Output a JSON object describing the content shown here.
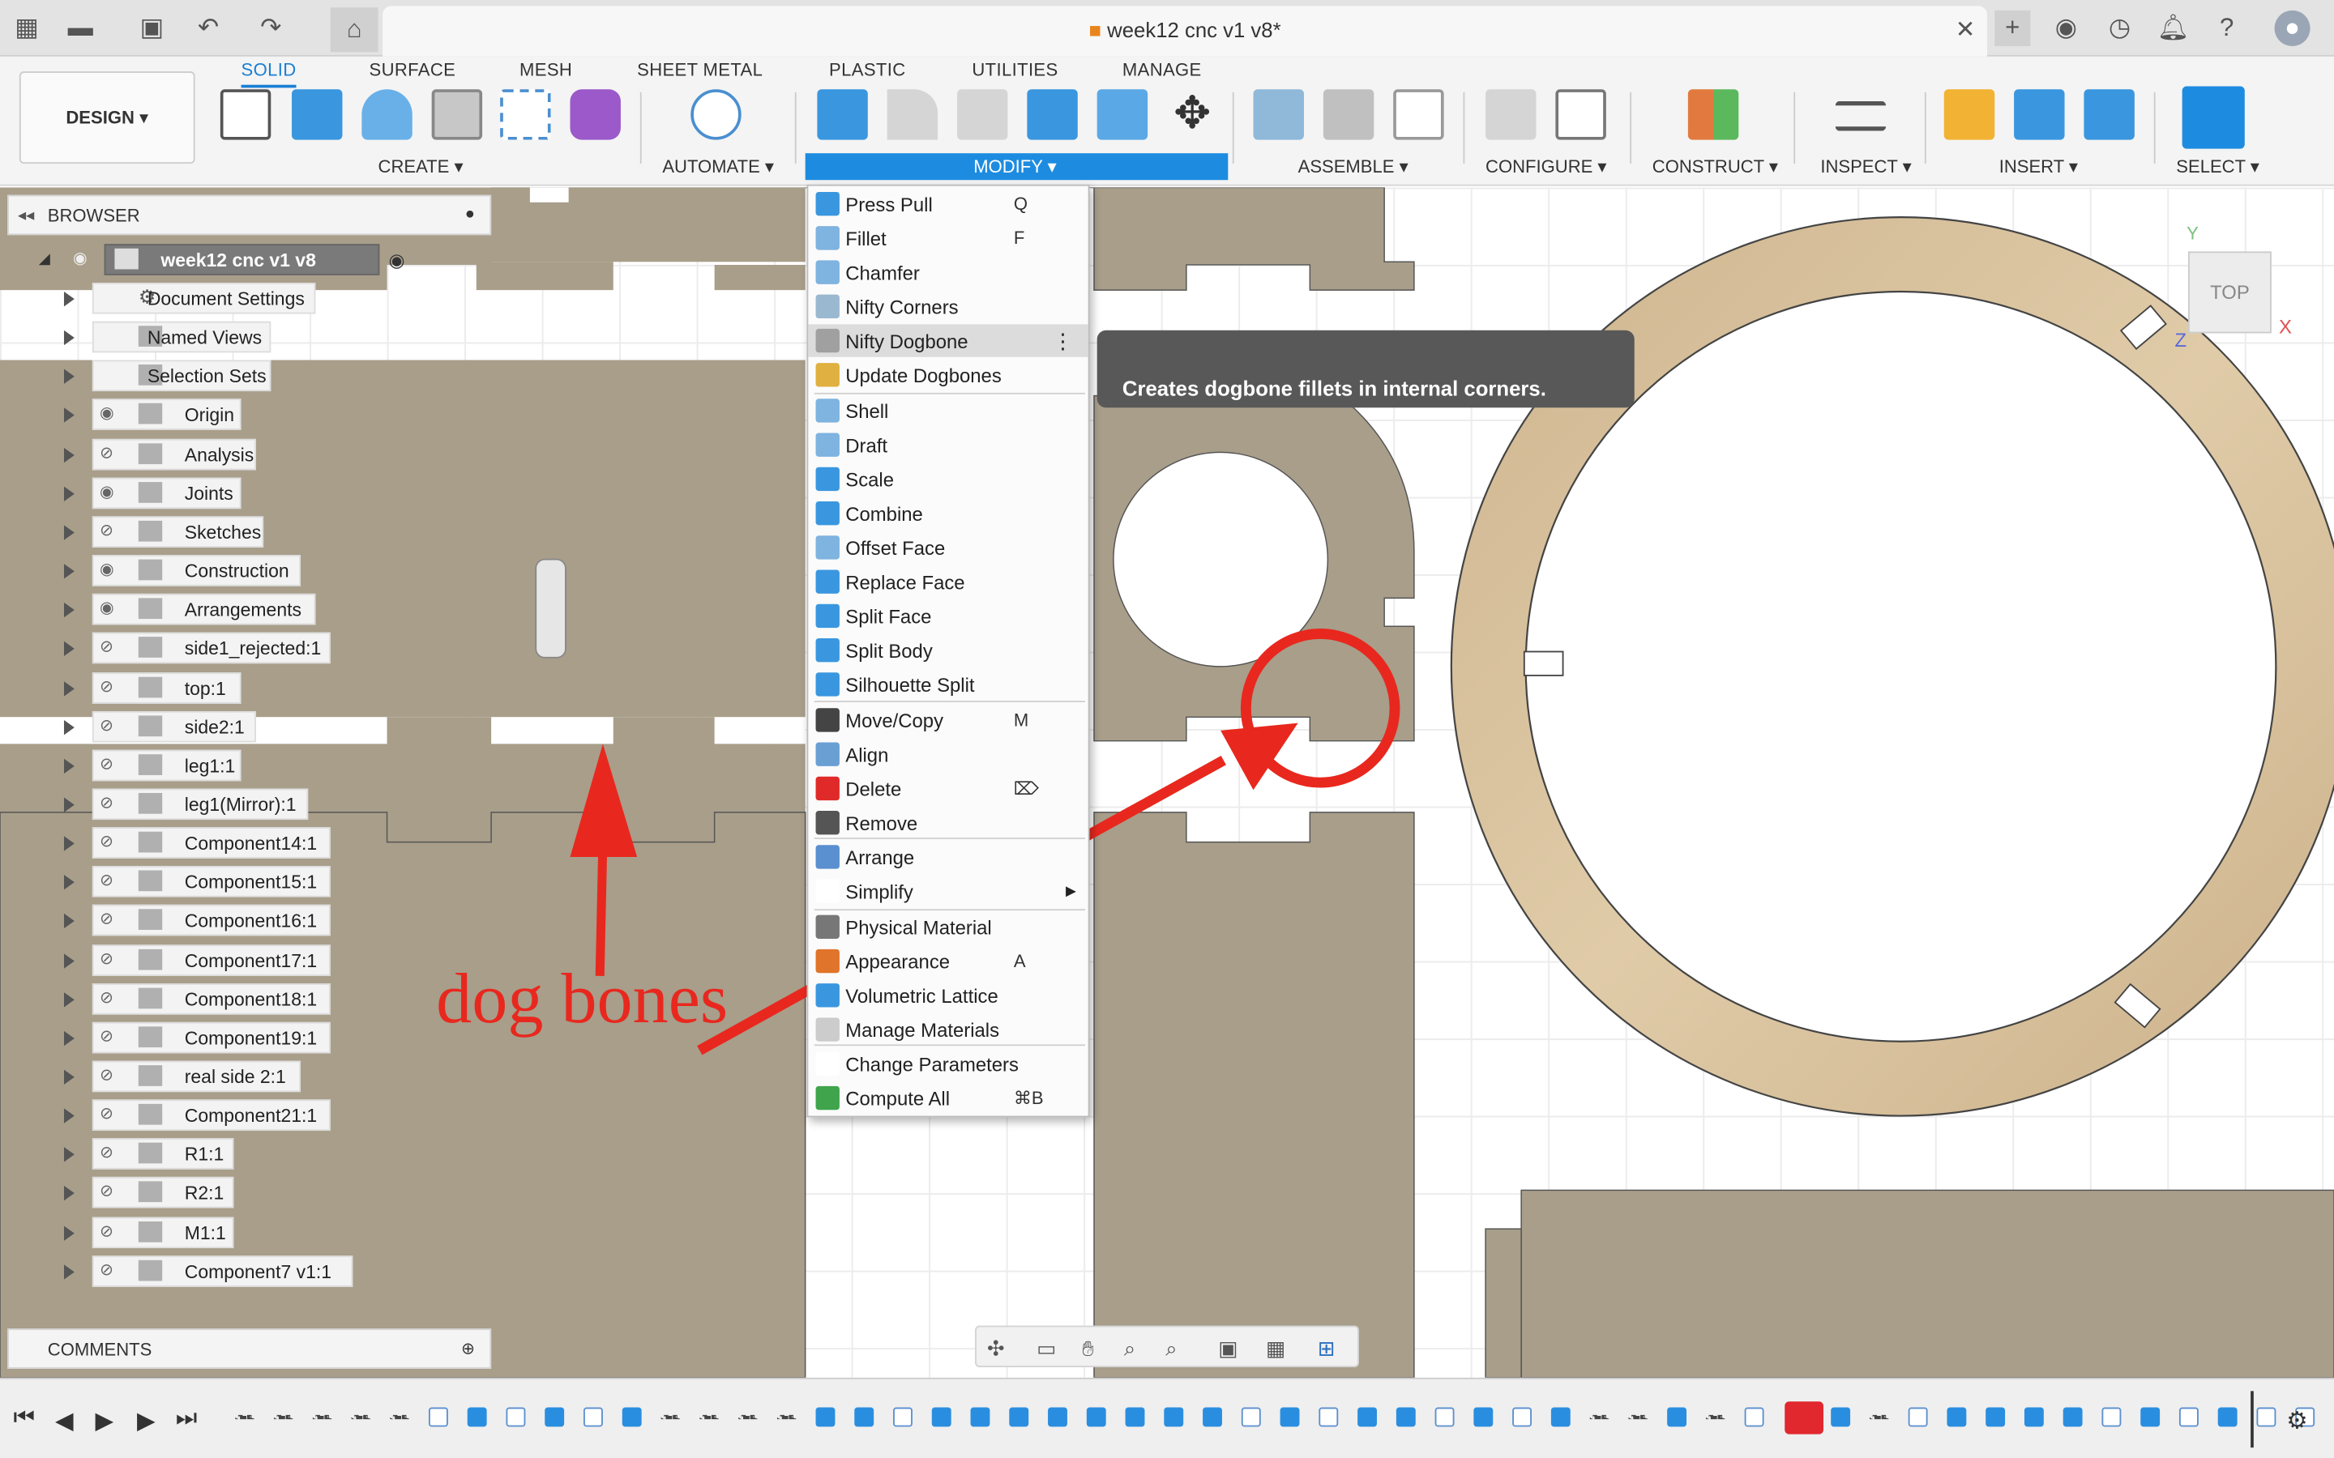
{
  "document": {
    "title": "week12 cnc v1 v8*"
  },
  "tabs": [
    "SOLID",
    "SURFACE",
    "MESH",
    "SHEET METAL",
    "PLASTIC",
    "UTILITIES",
    "MANAGE"
  ],
  "design_button": "DESIGN",
  "groups": {
    "create": "CREATE",
    "automate": "AUTOMATE",
    "modify": "MODIFY",
    "assemble": "ASSEMBLE",
    "configure": "CONFIGURE",
    "construct": "CONSTRUCT",
    "inspect": "INSPECT",
    "insert": "INSERT",
    "select": "SELECT"
  },
  "browser": {
    "title": "BROWSER",
    "root": "week12 cnc v1 v8",
    "items": [
      "Document Settings",
      "Named Views",
      "Selection Sets",
      "Origin",
      "Analysis",
      "Joints",
      "Sketches",
      "Construction",
      "Arrangements",
      "side1_rejected:1",
      "top:1",
      "side2:1",
      "leg1:1",
      "leg1(Mirror):1",
      "Component14:1",
      "Component15:1",
      "Component16:1",
      "Component17:1",
      "Component18:1",
      "Component19:1",
      "real side 2:1",
      "Component21:1",
      "R1:1",
      "R2:1",
      "M1:1",
      "Component7 v1:1"
    ]
  },
  "comments": {
    "title": "COMMENTS"
  },
  "modify_menu": {
    "items": [
      {
        "label": "Press Pull",
        "shortcut": "Q"
      },
      {
        "label": "Fillet",
        "shortcut": "F"
      },
      {
        "label": "Chamfer",
        "shortcut": ""
      },
      {
        "label": "Nifty Corners",
        "shortcut": ""
      },
      {
        "label": "Nifty Dogbone",
        "shortcut": ""
      },
      {
        "label": "Update Dogbones",
        "shortcut": ""
      },
      {
        "label": "Shell",
        "shortcut": ""
      },
      {
        "label": "Draft",
        "shortcut": ""
      },
      {
        "label": "Scale",
        "shortcut": ""
      },
      {
        "label": "Combine",
        "shortcut": ""
      },
      {
        "label": "Offset Face",
        "shortcut": ""
      },
      {
        "label": "Replace Face",
        "shortcut": ""
      },
      {
        "label": "Split Face",
        "shortcut": ""
      },
      {
        "label": "Split Body",
        "shortcut": ""
      },
      {
        "label": "Silhouette Split",
        "shortcut": ""
      },
      {
        "label": "Move/Copy",
        "shortcut": "M"
      },
      {
        "label": "Align",
        "shortcut": ""
      },
      {
        "label": "Delete",
        "shortcut": "⌦"
      },
      {
        "label": "Remove",
        "shortcut": ""
      },
      {
        "label": "Arrange",
        "shortcut": ""
      },
      {
        "label": "Simplify",
        "shortcut": ""
      },
      {
        "label": "Physical Material",
        "shortcut": ""
      },
      {
        "label": "Appearance",
        "shortcut": "A"
      },
      {
        "label": "Volumetric Lattice",
        "shortcut": ""
      },
      {
        "label": "Manage Materials",
        "shortcut": ""
      },
      {
        "label": "Change Parameters",
        "shortcut": ""
      },
      {
        "label": "Compute All",
        "shortcut": "⌘B"
      }
    ],
    "highlighted": "Nifty Dogbone"
  },
  "tooltip": "Creates dogbone fillets in internal corners.",
  "viewcube": {
    "face": "TOP",
    "axis_y": "Y",
    "axis_x": "X",
    "axis_z": "Z"
  },
  "annotation": "dog bones",
  "colors": {
    "accent": "#1a7fd4",
    "annotation": "#e8281e",
    "panel": "#a89e8a",
    "wood": "#d9c4a0"
  }
}
